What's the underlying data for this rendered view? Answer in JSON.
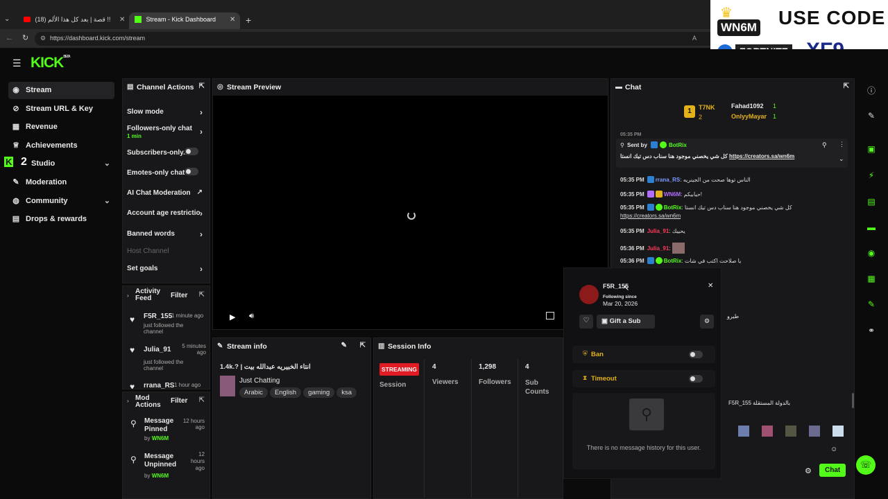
{
  "browser": {
    "tab1_title": "(18) قصة | بعد كل هذا الألم !!",
    "tab2_title": "Stream - Kick Dashboard",
    "url": "https://dashboard.kick.com/stream",
    "new_tab_glyph": "+"
  },
  "overlay_ad": {
    "line1": "USE CODE",
    "brand": "WN6M",
    "game": "FORTNITE",
    "code": "XF9"
  },
  "app": {
    "logo": "KICK",
    "logo_beta": "BETA",
    "sidebar": [
      {
        "label": "Stream",
        "icon": "stream-icon"
      },
      {
        "label": "Stream URL & Key",
        "icon": "link-icon"
      },
      {
        "label": "Revenue",
        "icon": "revenue-icon"
      },
      {
        "label": "Achievements",
        "icon": "trophy-icon"
      },
      {
        "label": "Studio",
        "icon": "studio-icon"
      },
      {
        "label": "Moderation",
        "icon": "wrench-icon"
      },
      {
        "label": "Community",
        "icon": "globe-icon"
      },
      {
        "label": "Drops & rewards",
        "icon": "gift-icon"
      }
    ],
    "studio_badge": "2"
  },
  "channel_actions": {
    "title": "Channel Actions",
    "items": [
      {
        "label": "Slow mode"
      },
      {
        "label": "Followers-only chat",
        "sub": "1 min"
      },
      {
        "label": "Subscribers-only..."
      },
      {
        "label": "Emotes-only chat"
      },
      {
        "label": "AI Chat Moderation"
      },
      {
        "label": "Account age restrictio"
      },
      {
        "label": "Banned words"
      },
      {
        "label": "Host Channel"
      },
      {
        "label": "Set goals"
      }
    ]
  },
  "activity_feed": {
    "title": "Activity Feed",
    "filter": "Filter",
    "items": [
      {
        "user": "F5R_155",
        "time": "1 minute ago",
        "action": "just followed the channel"
      },
      {
        "user": "Julia_91",
        "time": "5 minutes ago",
        "action": "just followed the channel"
      },
      {
        "user": "rrana_RS",
        "time": "1 hour ago"
      }
    ]
  },
  "mod_actions": {
    "title": "Mod Actions",
    "filter": "Filter",
    "items": [
      {
        "action": "Message Pinned",
        "by": "by",
        "user": "WN6M",
        "time": "12 hours ago"
      },
      {
        "action": "Message Unpinned",
        "by": "by",
        "user": "WN6M",
        "time": "12 hours ago"
      }
    ]
  },
  "stream_preview": {
    "title": "Stream Preview"
  },
  "stream_info": {
    "title": "Stream info",
    "stream_title": "1.4k.? | انتاء الخبيريه عبدالله بيت",
    "category": "Just Chatting",
    "tags": [
      "Arabic",
      "English",
      "gaming",
      "ksa"
    ]
  },
  "session_info": {
    "title": "Session Info",
    "status": "STREAMING",
    "session_label": "Session",
    "viewers": "4",
    "viewers_label": "Viewers",
    "followers": "1,298",
    "followers_label": "Followers",
    "subs": "4",
    "subs_label": "Sub Counts"
  },
  "chat": {
    "title": "Chat",
    "leaderboard": {
      "rank1_user": "T7NK",
      "rank2_count": "2",
      "rank1_num": "1",
      "u2": "Fahad1092",
      "u2_count": "1",
      "u3": "OnlyyMayar",
      "u3_count": "1"
    },
    "pinned": {
      "label": "Sent by",
      "user": "BotRix",
      "text": "كل شي يخصني موجود هنا سناب دس تيك انستا",
      "link": "https://creators.sa/wn6m"
    },
    "partial_top": "05:35 PM",
    "messages": [
      {
        "time": "05:35 PM",
        "user": "rrana_RS",
        "text": "الناس توها صحت من الجينريه",
        "color": "#7c9cff"
      },
      {
        "time": "05:35 PM",
        "user": "WN6M",
        "text": "حيابيكم!",
        "color": "#b46cff"
      },
      {
        "time": "05:35 PM",
        "user": "BotRix",
        "text": "كل شي يخصني موجود هنا سناب دس تيك انستا",
        "link": "https://creators.sa/wn6m",
        "color": "#53fc18"
      },
      {
        "time": "05:35 PM",
        "user": "Julia_91",
        "text": "يحييك",
        "color": "#ff3b5b"
      },
      {
        "time": "05:36 PM",
        "user": "Julia_91",
        "text": "",
        "color": "#ff3b5b"
      },
      {
        "time": "05:36 PM",
        "user": "BotRix",
        "text": "يا صلاحت اكتب في شات",
        "color": "#53fc18"
      }
    ],
    "right_msg1": "طيرو",
    "right_msg2": "F5R_155 بالدولة المستقلة",
    "send_label": "Chat"
  },
  "user_card": {
    "username": "F5R_155",
    "following_label": "Following since",
    "following_date": "Mar 20, 2026",
    "gift_label": "Gift a Sub",
    "ban_label": "Ban",
    "timeout_label": "Timeout",
    "empty_text": "There is no message history for this user."
  },
  "colors": {
    "kick_green": "#53fc18",
    "streaming_red": "#e01b24",
    "panel_bg": "#18181a"
  }
}
